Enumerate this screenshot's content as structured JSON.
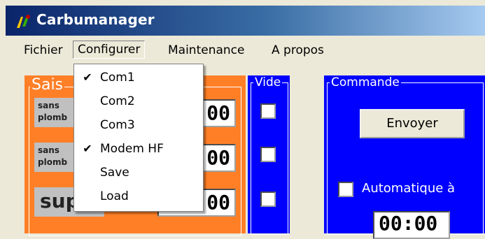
{
  "window": {
    "title": "Carbumanager"
  },
  "menubar": {
    "items": [
      {
        "label": "Fichier"
      },
      {
        "label": "Configurer"
      },
      {
        "label": "Maintenance"
      },
      {
        "label": "A propos"
      }
    ]
  },
  "configure_menu": {
    "items": [
      {
        "label": "Com1",
        "checked": true,
        "check_glyph": "✔"
      },
      {
        "label": "Com2",
        "checked": false,
        "check_glyph": ""
      },
      {
        "label": "Com3",
        "checked": false,
        "check_glyph": ""
      },
      {
        "label": "Modem HF",
        "checked": true,
        "check_glyph": "✔"
      },
      {
        "label": "Save",
        "checked": false,
        "check_glyph": ""
      },
      {
        "label": "Load",
        "checked": false,
        "check_glyph": ""
      }
    ]
  },
  "saisie_group": {
    "title": "Sais",
    "rows": [
      {
        "label_line1": "sans",
        "label_line2": "plomb",
        "value": "00"
      },
      {
        "label_line1": "sans",
        "label_line2": "plomb",
        "value": "00"
      },
      {
        "label_big": "sup",
        "value": "00"
      }
    ]
  },
  "vide_group": {
    "title": "Vide",
    "checkboxes": [
      false,
      false,
      false
    ]
  },
  "commande_group": {
    "title": "Commande",
    "send_button": "Envoyer",
    "auto_label": "Automatique à",
    "auto_checked": false,
    "time": "00:00"
  },
  "colors": {
    "orange": "#ff7f27",
    "blue": "#0000ff",
    "titlebar": "#0a246a",
    "window_bg": "#ece9d8"
  }
}
